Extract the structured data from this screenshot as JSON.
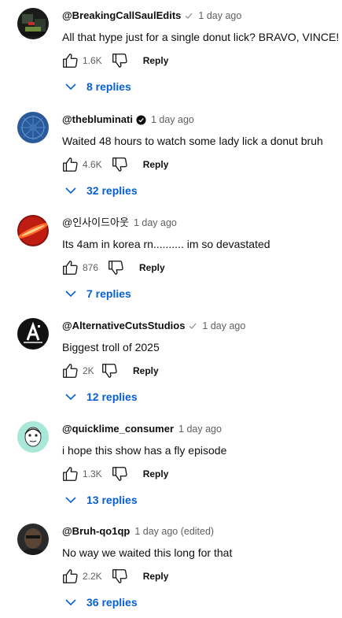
{
  "colors": {
    "link": "#065fd4",
    "secondary": "#606060",
    "text": "#0f0f0f"
  },
  "comments": [
    {
      "author": "@BreakingCallSaulEdits",
      "verified": "check",
      "time": "1 day ago",
      "text": "All that hype just for a single donut lick? BRAVO, VINCE!",
      "likes": "1.6K",
      "reply": "Reply",
      "replies": "8 replies",
      "avatar_icon": "dark-scene-avatar"
    },
    {
      "author": "@thebluminati",
      "verified": "badge",
      "time": "1 day ago",
      "text": "Waited 48 hours to watch some lady lick a donut bruh",
      "likes": "4.6K",
      "reply": "Reply",
      "replies": "32 replies",
      "avatar_icon": "blue-pattern-avatar"
    },
    {
      "author": "@인사이드아웃",
      "verified": "",
      "time": "1 day ago",
      "text": "Its 4am in korea rn.......... im so devastated",
      "likes": "876",
      "reply": "Reply",
      "replies": "7 replies",
      "avatar_icon": "red-glow-avatar"
    },
    {
      "author": "@AlternativeCutsStudios",
      "verified": "check",
      "time": "1 day ago",
      "text": "Biggest troll of 2025",
      "likes": "2K",
      "reply": "Reply",
      "replies": "12 replies",
      "avatar_icon": "alternative-logo-avatar"
    },
    {
      "author": "@quicklime_consumer",
      "verified": "",
      "time": "1 day ago",
      "text": "i hope this show has a fly episode",
      "likes": "1.3K",
      "reply": "Reply",
      "replies": "13 replies",
      "avatar_icon": "cartoon-face-avatar"
    },
    {
      "author": "@Bruh-qo1qp",
      "verified": "",
      "time": "1 day ago (edited)",
      "text": "No way we waited this long for that",
      "likes": "2.2K",
      "reply": "Reply",
      "replies": "36 replies",
      "avatar_icon": "dark-portrait-avatar"
    }
  ]
}
